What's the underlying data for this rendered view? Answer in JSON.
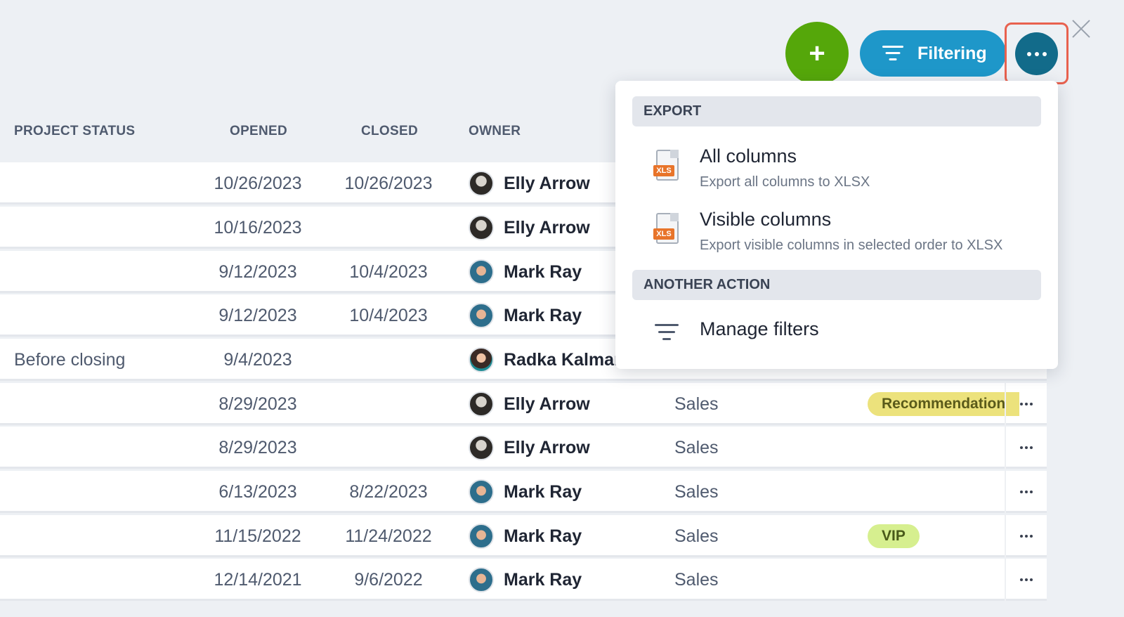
{
  "toolbar": {
    "add_label": "+",
    "filtering_label": "Filtering",
    "more_label": "More actions"
  },
  "columns": [
    "PROJECT STATUS",
    "OPENED",
    "CLOSED",
    "OWNER"
  ],
  "rows": [
    {
      "status": "",
      "opened": "10/26/2023",
      "closed": "10/26/2023",
      "owner": "Elly Arrow",
      "avatar": "elly",
      "dept": "",
      "tag": "",
      "tag_kind": ""
    },
    {
      "status": "",
      "opened": "10/16/2023",
      "closed": "",
      "owner": "Elly Arrow",
      "avatar": "elly",
      "dept": "",
      "tag": "",
      "tag_kind": ""
    },
    {
      "status": "",
      "opened": "9/12/2023",
      "closed": "10/4/2023",
      "owner": "Mark Ray",
      "avatar": "mark",
      "dept": "",
      "tag": "",
      "tag_kind": ""
    },
    {
      "status": "",
      "opened": "9/12/2023",
      "closed": "10/4/2023",
      "owner": "Mark Ray",
      "avatar": "mark",
      "dept": "",
      "tag": "",
      "tag_kind": ""
    },
    {
      "status": "Before closing",
      "opened": "9/4/2023",
      "closed": "",
      "owner": "Radka Kalmar",
      "avatar": "radka",
      "dept": "",
      "tag": "",
      "tag_kind": ""
    },
    {
      "status": "",
      "opened": "8/29/2023",
      "closed": "",
      "owner": "Elly Arrow",
      "avatar": "elly",
      "dept": "Sales",
      "tag": "Recommendation",
      "tag_kind": "rec"
    },
    {
      "status": "",
      "opened": "8/29/2023",
      "closed": "",
      "owner": "Elly Arrow",
      "avatar": "elly",
      "dept": "Sales",
      "tag": "",
      "tag_kind": ""
    },
    {
      "status": "",
      "opened": "6/13/2023",
      "closed": "8/22/2023",
      "owner": "Mark Ray",
      "avatar": "mark",
      "dept": "Sales",
      "tag": "",
      "tag_kind": ""
    },
    {
      "status": "",
      "opened": "11/15/2022",
      "closed": "11/24/2022",
      "owner": "Mark Ray",
      "avatar": "mark",
      "dept": "Sales",
      "tag": "VIP",
      "tag_kind": "vip"
    },
    {
      "status": "",
      "opened": "12/14/2021",
      "closed": "9/6/2022",
      "owner": "Mark Ray",
      "avatar": "mark",
      "dept": "Sales",
      "tag": "",
      "tag_kind": ""
    }
  ],
  "row_menu_visible_from": 5,
  "menu": {
    "export_header": "EXPORT",
    "all_columns_title": "All columns",
    "all_columns_sub": "Export all columns to XLSX",
    "visible_columns_title": "Visible columns",
    "visible_columns_sub": "Export visible columns in selected order to XLSX",
    "file_badge": "XLS",
    "another_header": "ANOTHER ACTION",
    "manage_filters": "Manage filters"
  },
  "colors": {
    "add": "#55a70a",
    "filtering": "#1e97c9",
    "more": "#126b8a",
    "focus_ring": "#e8614e",
    "tag_recommendation": "#ece27c",
    "tag_vip": "#d6ef8f"
  }
}
